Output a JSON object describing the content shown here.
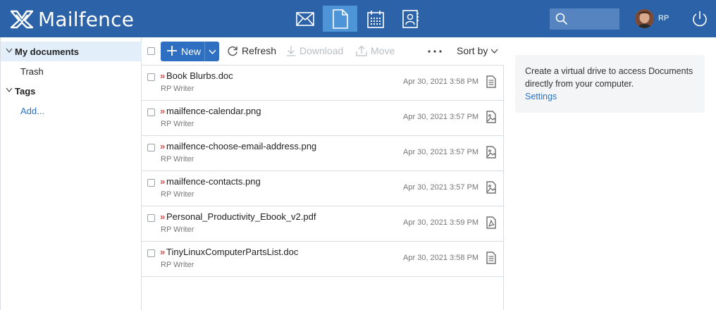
{
  "brand": {
    "name": "Mailfence"
  },
  "header": {
    "apps": [
      {
        "name": "mail",
        "icon": "envelope-icon",
        "active": false
      },
      {
        "name": "documents",
        "icon": "document-icon",
        "active": true
      },
      {
        "name": "calendar",
        "icon": "calendar-icon",
        "active": false
      },
      {
        "name": "contacts",
        "icon": "contacts-icon",
        "active": false
      }
    ],
    "search": {
      "placeholder": ""
    },
    "user": {
      "initials": "RP"
    }
  },
  "sidebar": {
    "my_documents": "My documents",
    "trash": "Trash",
    "tags": "Tags",
    "add": "Add..."
  },
  "toolbar": {
    "new_label": "New",
    "refresh_label": "Refresh",
    "download_label": "Download",
    "move_label": "Move",
    "more": "...",
    "sort_label": "Sort by"
  },
  "documents": [
    {
      "name": "Book Blurbs.doc",
      "owner": "RP Writer",
      "date": "Apr 30, 2021 3:58 PM",
      "type": "doc"
    },
    {
      "name": "mailfence-calendar.png",
      "owner": "RP Writer",
      "date": "Apr 30, 2021 3:57 PM",
      "type": "image"
    },
    {
      "name": "mailfence-choose-email-address.png",
      "owner": "RP Writer",
      "date": "Apr 30, 2021 3:57 PM",
      "type": "image"
    },
    {
      "name": "mailfence-contacts.png",
      "owner": "RP Writer",
      "date": "Apr 30, 2021 3:57 PM",
      "type": "image"
    },
    {
      "name": "Personal_Productivity_Ebook_v2.pdf",
      "owner": "RP Writer",
      "date": "Apr 30, 2021 3:59 PM",
      "type": "pdf"
    },
    {
      "name": "TinyLinuxComputerPartsList.doc",
      "owner": "RP Writer",
      "date": "Apr 30, 2021 3:58 PM",
      "type": "doc"
    }
  ],
  "info_panel": {
    "text": "Create a virtual drive to access Documents directly from your computer.",
    "link": "Settings"
  },
  "colors": {
    "header_bg": "#2c62a7",
    "active_app": "#4d95d6",
    "primary_button": "#2e6fc1",
    "link": "#2e72c4",
    "selected_row": "#e3eefb"
  }
}
